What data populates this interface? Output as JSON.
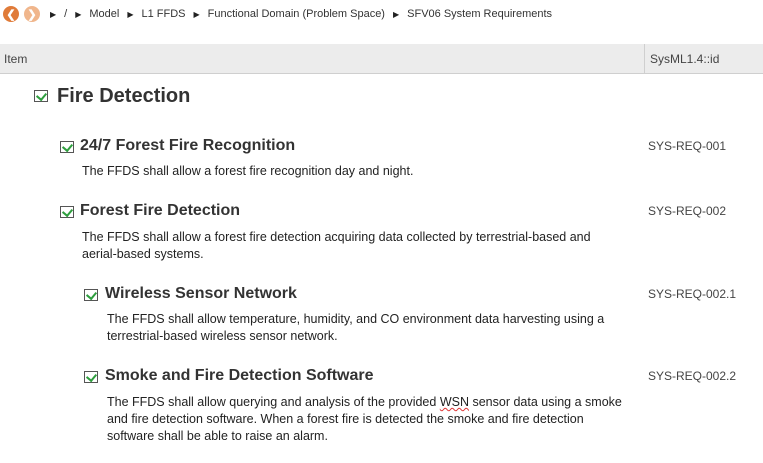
{
  "breadcrumb": [
    "/",
    "Model",
    "L1 FFDS",
    "Functional Domain (Problem Space)",
    "SFV06 System Requirements"
  ],
  "columns": {
    "item": "Item",
    "id": "SysML1.4::id"
  },
  "section": {
    "title": "Fire Detection"
  },
  "requirements": [
    {
      "title": "24/7 Forest Fire Recognition",
      "id": "SYS-REQ-001",
      "text": "The FFDS shall allow a forest fire recognition day and night."
    },
    {
      "title": "Forest Fire Detection",
      "id": "SYS-REQ-002",
      "text_lines": [
        "The FFDS shall allow a forest fire detection acquiring data collected by terrestrial-based and",
        "aerial-based systems."
      ]
    },
    {
      "title": "Wireless Sensor Network",
      "id": "SYS-REQ-002.1",
      "text_lines": [
        "The FFDS shall allow temperature, humidity, and CO environment data harvesting using a",
        "terrestrial-based wireless sensor network."
      ]
    },
    {
      "title": "Smoke and Fire Detection Software",
      "id": "SYS-REQ-002.2",
      "text_line1_pre": "The FFDS shall allow querying and analysis of the provided ",
      "text_line1_wsn": "WSN",
      "text_line1_post": " sensor data using a smoke",
      "text_lines": [
        "and fire detection software. When a forest fire is detected the smoke and fire detection",
        "software shall be able to raise an alarm."
      ]
    }
  ],
  "colors": {
    "back_button": "#e07b39",
    "forward_button": "#f0b68c",
    "check": "#2e9e3e"
  }
}
